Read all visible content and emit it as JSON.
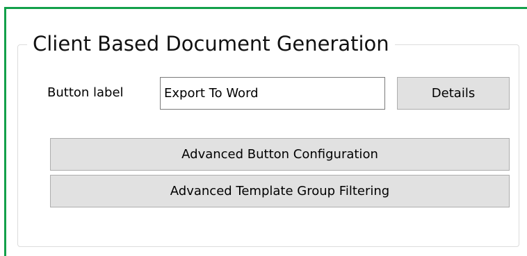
{
  "group": {
    "title": "Client Based Document Generation"
  },
  "form": {
    "button_label_caption": "Button label",
    "button_label_value": "Export To Word",
    "details_button": "Details"
  },
  "actions": {
    "advanced_button_configuration": "Advanced Button Configuration",
    "advanced_template_group_filtering": "Advanced Template Group Filtering"
  },
  "colors": {
    "frame_accent": "#12a04a",
    "button_face": "#e1e1e1",
    "button_border": "#adadad"
  }
}
